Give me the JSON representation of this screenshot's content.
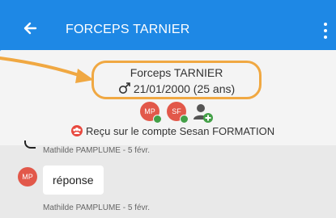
{
  "appbar": {
    "title": "FORCEPS TARNIER"
  },
  "patient": {
    "name": "Forceps TARNIER",
    "dob_age": "21/01/2000 (25 ans)"
  },
  "participants": [
    {
      "initials": "MP",
      "color": "#e2584a",
      "status_color": "#43a047"
    },
    {
      "initials": "SF",
      "color": "#e2584a",
      "status_color": "#43a047"
    }
  ],
  "account": {
    "text": "Reçu sur le compte Sesan FORMATION"
  },
  "messages": [
    {
      "author_time": "Mathilde PAMPLUME - 5 févr."
    },
    {
      "avatar": "MP",
      "text": "réponse",
      "author_time": "Mathilde PAMPLUME - 5 févr."
    }
  ],
  "colors": {
    "appbar": "#1e88e5",
    "highlight": "#f0a842",
    "accent_red": "#e8483e"
  }
}
